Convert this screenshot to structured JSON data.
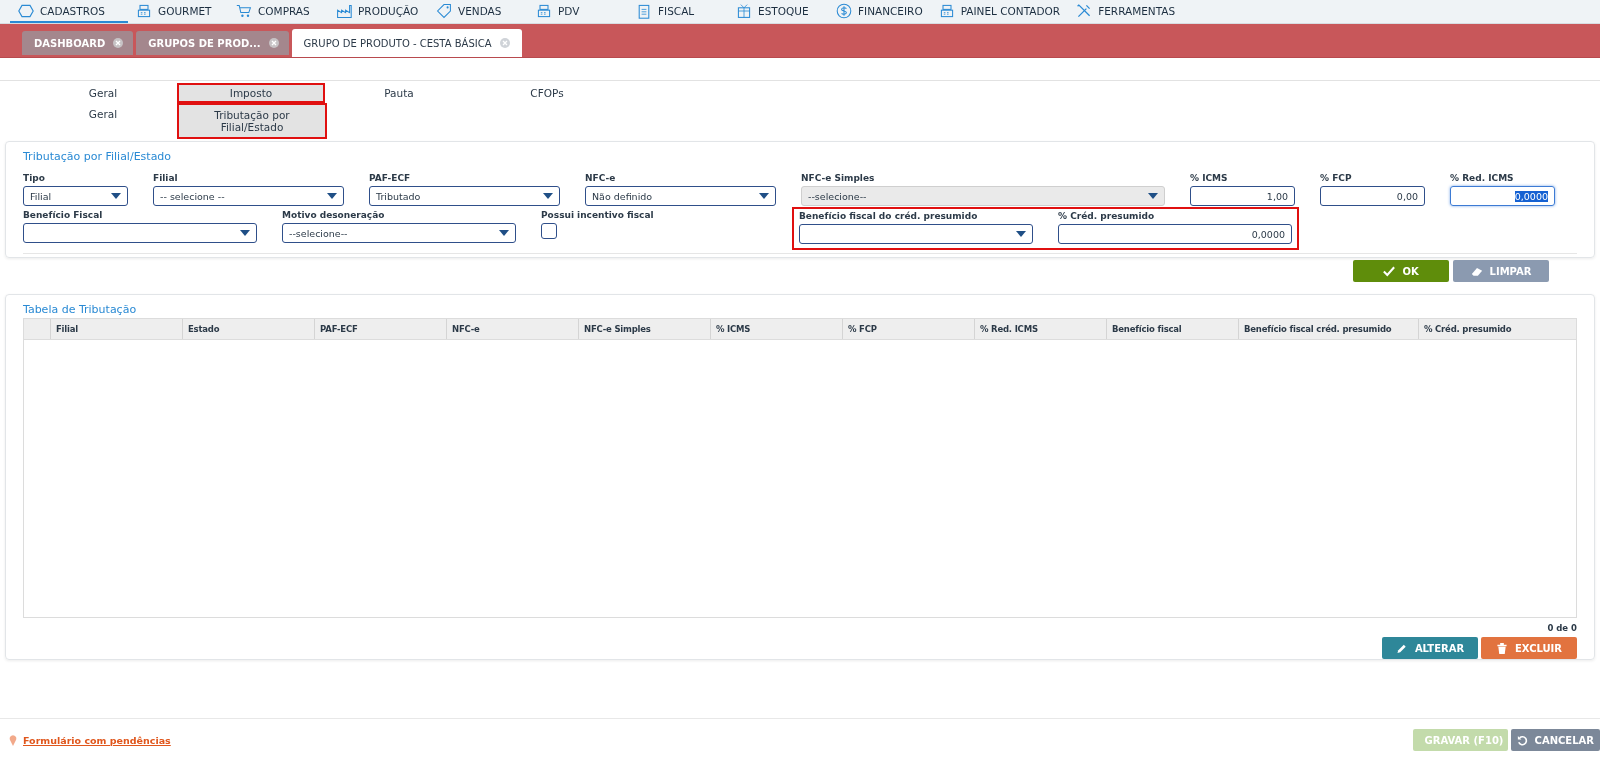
{
  "menu": [
    {
      "label": "CADASTROS",
      "selected": true
    },
    {
      "label": "GOURMET",
      "selected": false
    },
    {
      "label": "COMPRAS",
      "selected": false
    },
    {
      "label": "PRODUÇÃO",
      "selected": false
    },
    {
      "label": "VENDAS",
      "selected": false
    },
    {
      "label": "PDV",
      "selected": false
    },
    {
      "label": "FISCAL",
      "selected": false
    },
    {
      "label": "ESTOQUE",
      "selected": false
    },
    {
      "label": "FINANCEIRO",
      "selected": false
    },
    {
      "label": "PAINEL CONTADOR",
      "selected": false
    },
    {
      "label": "FERRAMENTAS",
      "selected": false
    }
  ],
  "doc_tabs": [
    {
      "label": "DASHBOARD",
      "selected": false
    },
    {
      "label": "GRUPOS DE PROD...",
      "selected": false
    },
    {
      "label": "GRUPO DE PRODUTO - CESTA BÁSICA",
      "selected": true
    }
  ],
  "section_tabs": [
    {
      "label": "Geral",
      "selected": false
    },
    {
      "label": "Imposto",
      "selected": true
    },
    {
      "label": "Pauta",
      "selected": false
    },
    {
      "label": "CFOPs",
      "selected": false
    }
  ],
  "sub_tabs": [
    {
      "label": "Geral",
      "selected": false
    },
    {
      "label": "Tributação por Filial/Estado",
      "selected": true
    }
  ],
  "form": {
    "title": "Tributação por Filial/Estado",
    "row_1": [
      {
        "kind": "select",
        "label": "Tipo",
        "value": "Filial",
        "disabled": false,
        "focused": false
      },
      {
        "kind": "select",
        "label": "Filial",
        "value": "-- selecione --",
        "disabled": false,
        "focused": false
      },
      {
        "kind": "select",
        "label": "PAF-ECF",
        "value": "Tributado",
        "disabled": false,
        "focused": false
      },
      {
        "kind": "select",
        "label": "NFC-e",
        "value": "Não definido",
        "disabled": false,
        "focused": false
      },
      {
        "kind": "select",
        "label": "NFC-e Simples",
        "value": "--selecione--",
        "disabled": true,
        "focused": false
      },
      {
        "kind": "number",
        "label": "% ICMS",
        "value": "1,00",
        "disabled": false,
        "focused": false
      },
      {
        "kind": "number",
        "label": "% FCP",
        "value": "0,00",
        "disabled": false,
        "focused": false
      },
      {
        "kind": "number",
        "label": "% Red. ICMS",
        "value": "0,0000",
        "disabled": false,
        "focused": true
      }
    ],
    "row_2": [
      {
        "kind": "select",
        "label": "Benefício Fiscal",
        "disabled": false,
        "focused": false
      },
      {
        "kind": "select",
        "label": "Motivo desoneração",
        "value": "--selecione--",
        "disabled": false,
        "focused": false
      },
      {
        "kind": "checkbox",
        "label": "Possui incentivo fiscal",
        "checked": false
      }
    ],
    "highlighted": [
      {
        "kind": "select",
        "label": "Benefício fiscal do créd. presumido",
        "disabled": false,
        "focused": false
      },
      {
        "kind": "number",
        "label": "% Créd. presumido",
        "value": "0,0000",
        "disabled": false,
        "focused": false
      }
    ],
    "buttons": [
      {
        "label": "OK",
        "kind": "ok"
      },
      {
        "label": "LIMPAR",
        "kind": "clear"
      }
    ]
  },
  "table": {
    "title": "Tabela de Tributação",
    "columns": [
      "Filial",
      "Estado",
      "PAF-ECF",
      "NFC-e",
      "NFC-e Simples",
      "% ICMS",
      "% FCP",
      "% Red. ICMS",
      "Benefício fiscal",
      "Benefício fiscal créd. presumido",
      "% Créd. presumido"
    ],
    "count": "0 de 0",
    "buttons": [
      {
        "label": "ALTERAR",
        "kind": "edit"
      },
      {
        "label": "EXCLUIR",
        "kind": "delete"
      }
    ]
  },
  "footer": {
    "warning": "Formulário com pendências",
    "buttons": [
      {
        "label": "GRAVAR (F10)",
        "kind": "save",
        "disabled": true
      },
      {
        "label": "CANCELAR",
        "kind": "cancel",
        "disabled": false
      }
    ]
  }
}
